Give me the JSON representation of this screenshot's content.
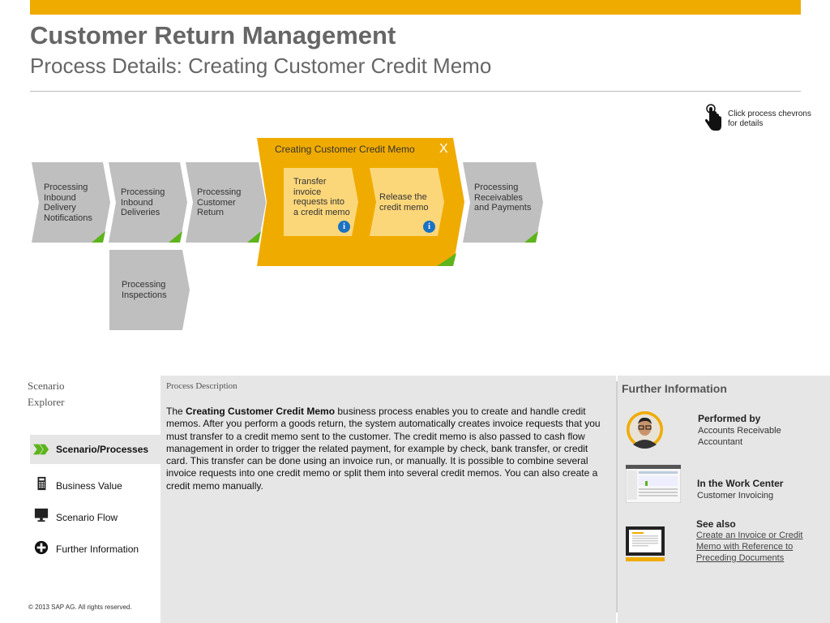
{
  "header": {
    "title": "Customer Return Management",
    "subtitle": "Process Details: Creating Customer Credit Memo"
  },
  "hint": {
    "text": "Click process chevrons for details",
    "icon": "hand-pointer-icon"
  },
  "chevrons": [
    {
      "label": "Processing Inbound Delivery Notifications"
    },
    {
      "label": "Processing Inbound Deliveries"
    },
    {
      "label": "Processing Customer Return"
    },
    {
      "label": "Processing Receivables and Payments"
    },
    {
      "label": "Processing Inspections"
    }
  ],
  "group": {
    "title": "Creating Customer Credit Memo",
    "close": "X",
    "steps": [
      {
        "label": "Transfer invoice requests into a credit memo",
        "info": "i"
      },
      {
        "label": "Release the credit memo",
        "info": "i"
      }
    ]
  },
  "nav": {
    "title_line1": "Scenario",
    "title_line2": "Explorer",
    "items": [
      {
        "label": "Scenario/Processes",
        "icon": "double-chevron-icon",
        "active": true
      },
      {
        "label": "Business Value",
        "icon": "calculator-icon"
      },
      {
        "label": "Scenario Flow",
        "icon": "monitor-icon"
      },
      {
        "label": "Further Information",
        "icon": "plus-circle-icon"
      }
    ]
  },
  "description": {
    "heading": "Process Description",
    "intro": "The ",
    "bold": "Creating Customer Credit Memo",
    "body": " business process enables you to create and handle credit memos. After you perform a goods return, the system automatically creates invoice requests that you must transfer to a credit memo sent to the customer. The credit memo is also passed to cash flow management in order to trigger the related payment, for example by check, bank transfer, or credit card. This transfer can be done using an invoice run, or manually. It is possible to combine several invoice requests into one credit memo or split them into several credit memos. You can also create a credit memo manually."
  },
  "further": {
    "heading": "Further Information",
    "performed_by_title": "Performed by",
    "performed_by_value": "Accounts Receivable Accountant",
    "work_center_title": "In the Work Center",
    "work_center_value": "Customer Invoicing",
    "see_also_title": "See also",
    "see_also_link": "Create an Invoice or Credit Memo with Reference to Preceding Documents"
  },
  "footer": {
    "copyright": "©  2013 SAP AG. All rights reserved."
  },
  "colors": {
    "accent": "#f0ab00",
    "chevron": "#bfbfbf",
    "step": "#fcd77a",
    "green": "#5db41b",
    "info": "#1a72c4"
  }
}
